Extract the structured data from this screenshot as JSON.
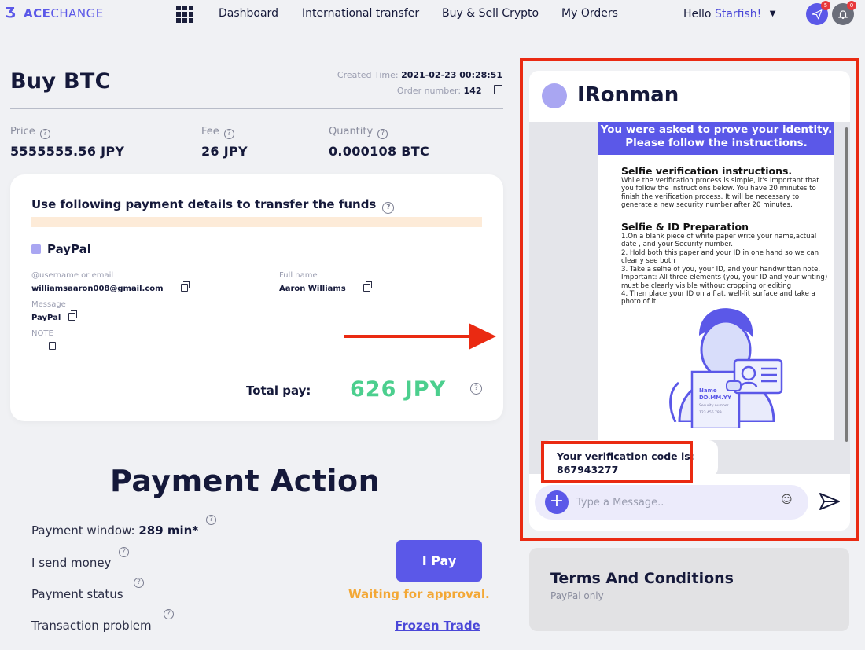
{
  "brand": {
    "name_bold": "ACE",
    "name_rest": "CHANGE"
  },
  "nav": {
    "items": [
      "Dashboard",
      "International transfer",
      "Buy & Sell Crypto",
      "My Orders"
    ],
    "greeting": "Hello",
    "username": "Starfish!",
    "messages_badge": "5",
    "notifications_badge": "0"
  },
  "order": {
    "title": "Buy BTC",
    "created_label": "Created Time:",
    "created_value": "2021-02-23 00:28:51",
    "order_label": "Order number:",
    "order_value": "142",
    "price_label": "Price",
    "price_value": "5555555.56 JPY",
    "fee_label": "Fee",
    "fee_value": "26 JPY",
    "quantity_label": "Quantity",
    "quantity_value": "0.000108 BTC"
  },
  "payment_card": {
    "title": "Use following payment details to transfer the funds",
    "method": "PayPal",
    "username_label": "@username or email",
    "username_value": "williamsaaron008@gmail.com",
    "fullname_label": "Full name",
    "fullname_value": "Aaron Williams",
    "message_label": "Message",
    "message_value": "PayPal",
    "note_label": "NOTE",
    "total_label": "Total pay:",
    "total_value": "626 JPY"
  },
  "payment_action": {
    "title": "Payment Action",
    "window_label": "Payment window:",
    "window_value": "289 min*",
    "send_label": "I send money",
    "status_label": "Payment status",
    "problem_label": "Transaction problem",
    "pay_button": "I Pay",
    "status_value": "Waiting for approval.",
    "frozen_link": "Frozen Trade"
  },
  "chat": {
    "name": "IRonman",
    "banner_line1": "You were asked to prove your identity.",
    "banner_line2": "Please follow the instructions.",
    "selfie_heading": "Selfie verification instructions.",
    "selfie_text": "While the verification process is simple, it's important that you follow the instructions below. You have 20 minutes to finish the verification process. It will be necessary to generate a new security number after 20 minutes.",
    "prep_heading": "Selfie & ID Preparation",
    "prep_1": "1.On a blank piece of white paper write your name,actual date , and your Security number.",
    "prep_2": "2.  Hold both this paper and your ID in one hand so we can clearly see both",
    "prep_3": "3.  Take a selfie of you, your ID, and your handwritten note. Important: All three elements (you, your ID and your writing) must be clearly visible without cropping or editing",
    "prep_4": "4.  Then place your ID on a flat, well-lit surface and take a photo of it",
    "card_name": "Name",
    "card_date": "DD.MM.YY",
    "card_sec": "Security number",
    "card_num": "123 456 789",
    "code_label": "Your verification code is:",
    "code_value": "867943277",
    "input_placeholder": "Type a Message.."
  },
  "terms": {
    "title": "Terms And Conditions",
    "subtitle": "PayPal only"
  },
  "colors": {
    "accent": "#5b58e8",
    "success": "#4ccf8e",
    "warning": "#f3a836",
    "highlight": "#ea2a12"
  }
}
